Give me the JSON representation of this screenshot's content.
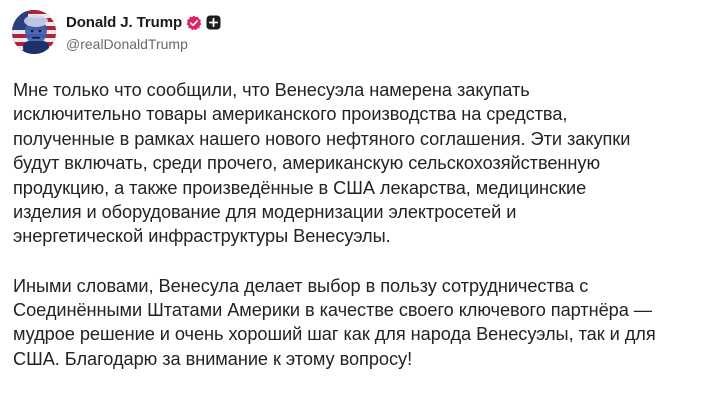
{
  "author": {
    "display_name": "Donald J. Trump",
    "handle": "@realDonaldTrump",
    "verified_icon": "verified-badge-icon",
    "follow_icon": "plus-square-icon"
  },
  "post": {
    "paragraphs": [
      {
        "lines": [
          "Мне только что сообщили, что Венесуэла намерена закупать",
          "исключительно товары американского производства на средства,",
          "полученные в рамках нашего нового нефтяного соглашения. Эти закупки",
          "будут включать, среди прочего, американскую сельскохозяйственную",
          "продукцию, а также произведённые в США лекарства, медицинские",
          "изделия и оборудование для модернизации электросетей и",
          "энергетической инфраструктуры Венесуэлы."
        ]
      },
      {
        "lines": [
          "Иными словами, Венесула делает выбор в пользу сотрудничества с",
          "Соединёнными Штатами Америки в качестве своего ключевого партнёра —",
          "мудрое решение и очень хороший шаг как для народа Венесуэлы, так и для",
          "США. Благодарю за внимание к этому вопросу!"
        ]
      }
    ]
  },
  "colors": {
    "badge_bg": "#e0245e",
    "text": "#222325",
    "handle": "#666a70"
  }
}
